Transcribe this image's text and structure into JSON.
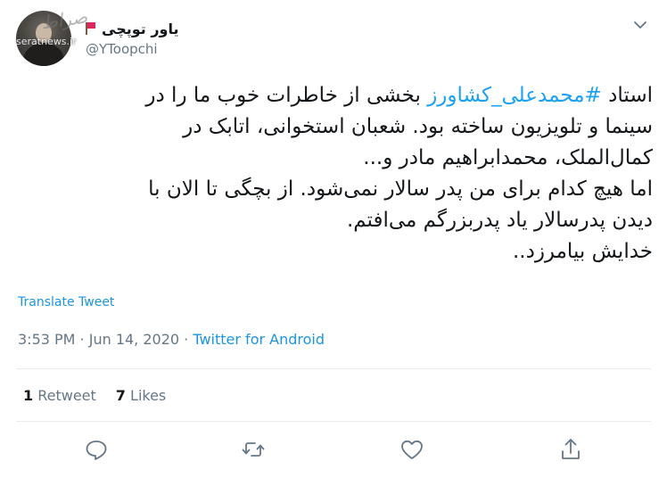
{
  "author": {
    "display_name": "یاور توپچی",
    "handle": "@YToopchi",
    "avatar_icon": "profile-avatar",
    "flag_icon": "red-flag"
  },
  "watermark": {
    "text": "seratnews.ir"
  },
  "tweet": {
    "hashtag": "#محمدعلی_کشاورز",
    "lines": [
      "استاد #محمدعلی_کشاورز بخشی از خاطرات خوب ما را در",
      "سینما و تلویزیون ساخته بود. شعبان استخوانی، اتابک در",
      "کمال‌الملک، محمدابراهیم مادر و...",
      "اما هیچ کدام برای من پدر سالار نمی‌شود. از بچگی تا الان با",
      "دیدن پدرسالار یاد پدربزرگم می‌افتم.",
      "خدایش بیامرزد.."
    ],
    "line_before_hashtag": "استاد ",
    "line_after_hashtag": " بخشی از خاطرات خوب ما را در"
  },
  "translate_label": "Translate Tweet",
  "meta": {
    "time": "3:53 PM",
    "separator": " · ",
    "date": "Jun 14, 2020",
    "source": "Twitter for Android"
  },
  "stats": {
    "retweets_count": "1",
    "retweets_label": "Retweet",
    "likes_count": "7",
    "likes_label": "Likes"
  },
  "actions": [
    "reply-icon",
    "retweet-icon",
    "like-icon",
    "share-icon"
  ],
  "colors": {
    "accent": "#1da1f2",
    "muted": "#657786",
    "text": "#14171a",
    "divider": "#e6ecf0"
  }
}
